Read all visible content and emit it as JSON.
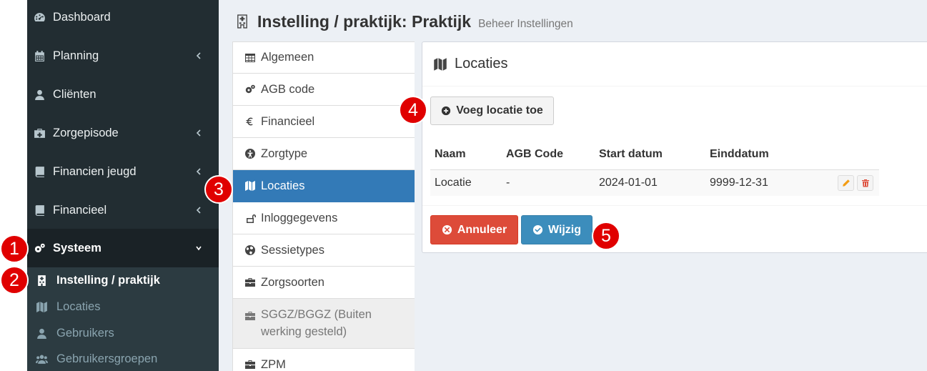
{
  "sidebar": {
    "items": [
      {
        "label": "Dashboard",
        "icon": "dashboard-icon"
      },
      {
        "label": "Planning",
        "icon": "calendar-icon"
      },
      {
        "label": "Cliënten",
        "icon": "user-icon"
      },
      {
        "label": "Zorgepisode",
        "icon": "medkit-icon"
      },
      {
        "label": "Financien jeugd",
        "icon": "book-icon"
      },
      {
        "label": "Financieel",
        "icon": "book-icon"
      },
      {
        "label": "Systeem",
        "icon": "gears-icon"
      }
    ],
    "submenu": [
      {
        "label": "Instelling / praktijk",
        "icon": "hospital-icon"
      },
      {
        "label": "Locaties",
        "icon": "map-icon"
      },
      {
        "label": "Gebruikers",
        "icon": "user-icon"
      },
      {
        "label": "Gebruikersgroepen",
        "icon": "users-icon"
      }
    ]
  },
  "header": {
    "title": "Instelling / praktijk: Praktijk",
    "subtitle": "Beheer Instellingen"
  },
  "nav": {
    "items": [
      {
        "label": "Algemeen",
        "icon": "table-icon"
      },
      {
        "label": "AGB code",
        "icon": "gears-icon"
      },
      {
        "label": "Financieel",
        "icon": "euro-icon"
      },
      {
        "label": "Zorgtype",
        "icon": "accessibility-icon"
      },
      {
        "label": "Locaties",
        "icon": "map-icon"
      },
      {
        "label": "Inloggegevens",
        "icon": "unlock-icon"
      },
      {
        "label": "Sessietypes",
        "icon": "globe-icon"
      },
      {
        "label": "Zorgsoorten",
        "icon": "briefcase-icon"
      },
      {
        "label": "SGGZ/BGGZ (Buiten werking gesteld)",
        "icon": "briefcase-icon"
      },
      {
        "label": "ZPM",
        "icon": "briefcase-icon"
      }
    ]
  },
  "box": {
    "title": "Locaties",
    "add_button": "Voeg locatie toe",
    "columns": [
      "Naam",
      "AGB Code",
      "Start datum",
      "Einddatum"
    ],
    "rows": [
      {
        "naam": "Locatie",
        "agb": "-",
        "start": "2024-01-01",
        "eind": "9999-12-31"
      }
    ],
    "cancel_button": "Annuleer",
    "save_button": "Wijzig"
  },
  "markers": [
    "1",
    "2",
    "3",
    "4",
    "5"
  ],
  "colors": {
    "sidebar_bg": "#222d32",
    "submenu_bg": "#2c3b41",
    "active_nav": "#337ab7",
    "danger": "#dd4b39",
    "primary": "#3c8dbc",
    "marker": "#e00000"
  }
}
